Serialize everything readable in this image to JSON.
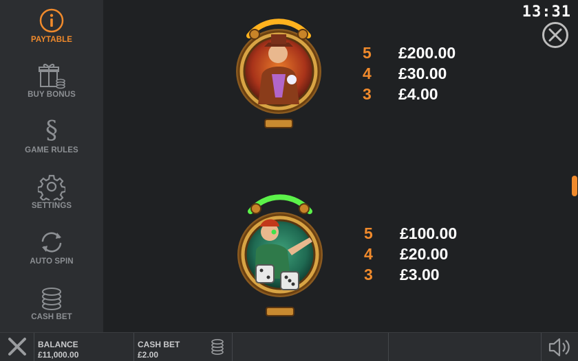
{
  "sidebar": {
    "items": [
      {
        "label": "PAYTABLE",
        "icon": "info-icon",
        "active": true
      },
      {
        "label": "BUY BONUS",
        "icon": "gift-icon",
        "active": false
      },
      {
        "label": "GAME RULES",
        "icon": "section-icon",
        "active": false
      },
      {
        "label": "SETTINGS",
        "icon": "gear-icon",
        "active": false
      },
      {
        "label": "AUTO SPIN",
        "icon": "autospin-icon",
        "active": false
      },
      {
        "label": "CASH BET",
        "icon": "coin-stack-icon",
        "active": false
      }
    ]
  },
  "header": {
    "clock": "13:31"
  },
  "paytable": {
    "symbols": [
      {
        "name": "gangster-symbol",
        "pays": [
          {
            "count": "5",
            "amount": "£200.00"
          },
          {
            "count": "4",
            "amount": "£30.00"
          },
          {
            "count": "3",
            "amount": "£4.00"
          }
        ]
      },
      {
        "name": "dice-symbol",
        "pays": [
          {
            "count": "5",
            "amount": "£100.00"
          },
          {
            "count": "4",
            "amount": "£20.00"
          },
          {
            "count": "3",
            "amount": "£3.00"
          }
        ]
      }
    ]
  },
  "footer": {
    "balance_label": "BALANCE",
    "balance_value": "£11,000.00",
    "cash_bet_label": "CASH BET",
    "cash_bet_value": "£2.00"
  },
  "colors": {
    "accent": "#f08a2c",
    "sidebar_bg": "#2c2e31",
    "main_bg": "#1f2123",
    "muted_text": "#8c8f93"
  }
}
